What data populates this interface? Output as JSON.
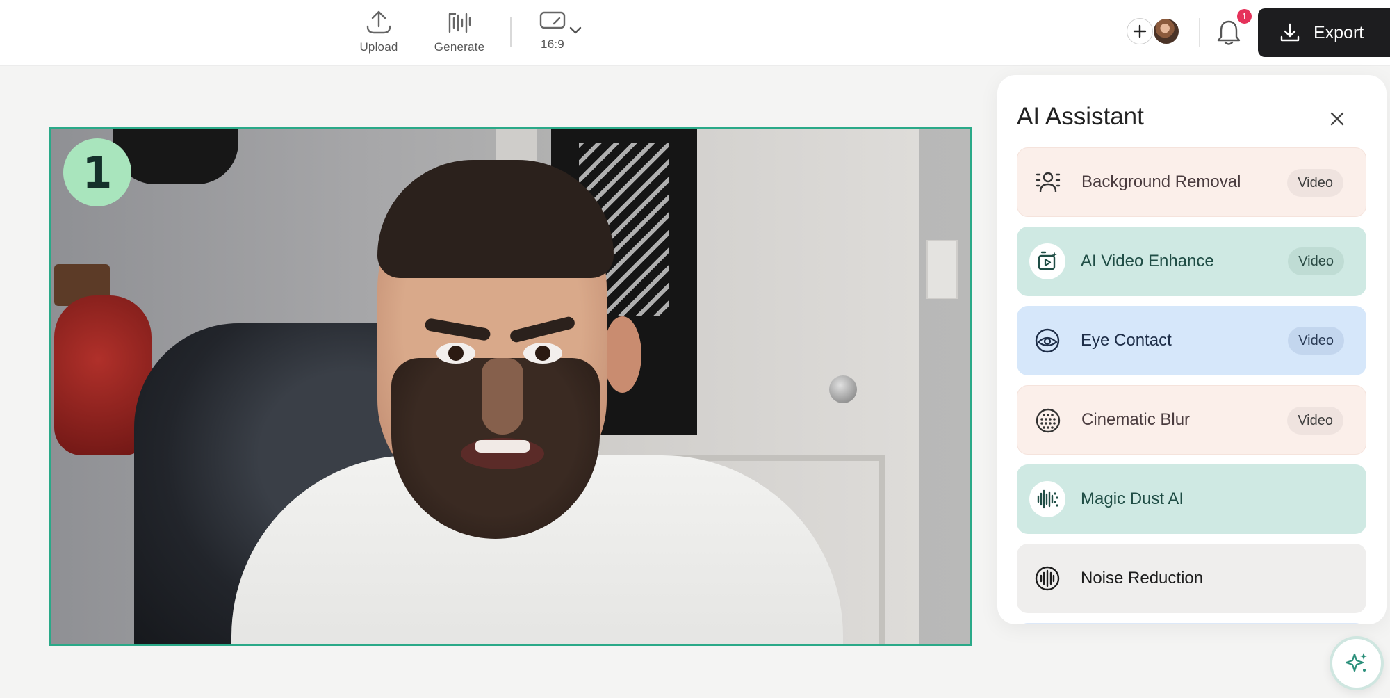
{
  "toolbar": {
    "upload_label": "Upload",
    "generate_label": "Generate",
    "aspect_ratio": "16:9",
    "notification_count": "1",
    "export_label": "Export"
  },
  "canvas": {
    "scene_number": "1"
  },
  "assistant": {
    "title": "AI Assistant",
    "tools": [
      {
        "label": "Background Removal",
        "tag": "Video",
        "icon": "person-frame-icon"
      },
      {
        "label": "AI Video Enhance",
        "tag": "Video",
        "icon": "video-enhance-icon"
      },
      {
        "label": "Eye Contact",
        "tag": "Video",
        "icon": "eye-icon"
      },
      {
        "label": "Cinematic Blur",
        "tag": "Video",
        "icon": "dotted-circle-icon"
      },
      {
        "label": "Magic Dust AI",
        "icon": "waveform-sparkle-icon"
      },
      {
        "label": "Noise Reduction",
        "icon": "waveform-circle-icon"
      }
    ]
  },
  "colors": {
    "accent": "#2aa988",
    "export_button": "#1d1d1f",
    "badge": "#e5325a"
  }
}
